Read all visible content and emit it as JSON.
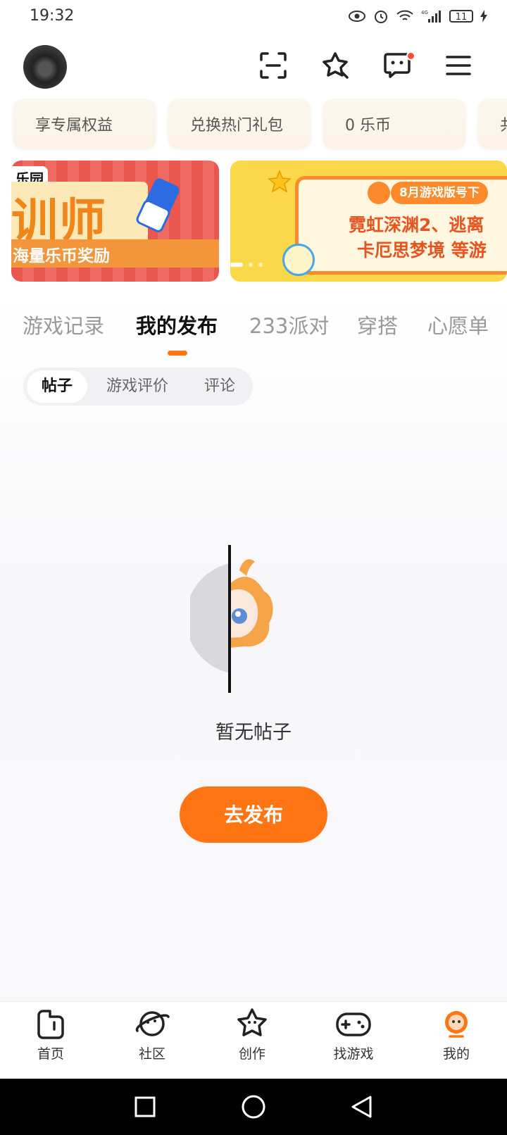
{
  "status_bar": {
    "time": "19:32",
    "battery": "11"
  },
  "benefits": [
    "享专属权益",
    "兑换热门礼包",
    "0 乐币",
    "共"
  ],
  "banners": {
    "left": {
      "tag": "乐园",
      "title": "训师",
      "subtitle": "海量乐币奖励"
    },
    "right": {
      "label": "8月游戏版号下",
      "line1": "霓虹深渊2、逃离",
      "line2": "卡厄思梦境 等游"
    }
  },
  "tabs": [
    "游戏记录",
    "我的发布",
    "233派对",
    "穿搭",
    "心愿单"
  ],
  "subtabs": [
    "帖子",
    "游戏评价",
    "评论"
  ],
  "empty": {
    "text": "暂无帖子",
    "button": "去发布"
  },
  "nav": [
    "首页",
    "社区",
    "创作",
    "找游戏",
    "我的"
  ],
  "colors": {
    "accent": "#ff7513"
  }
}
